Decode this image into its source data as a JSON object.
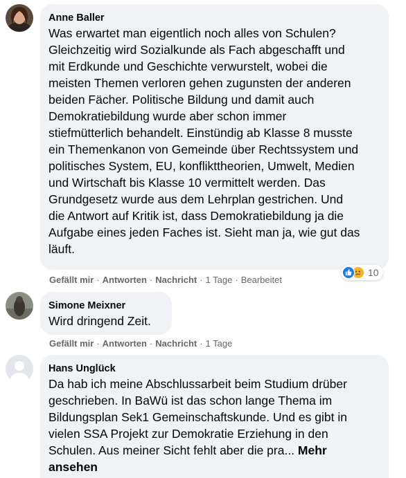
{
  "comments": [
    {
      "author": "Anne Baller",
      "lines": [
        "Was erwartet man eigentlich noch alles von Schulen?",
        "Gleichzeitig wird Sozialkunde als Fach abgeschafft und",
        "mit Erdkunde und Geschichte verwurstelt, wobei die",
        "meisten Themen verloren gehen zugunsten der anderen",
        "beiden Fächer. Politische Bildung und damit auch",
        "Demokratiebildung wurde aber schon immer",
        "stiefmütterlich behandelt. Einstündig ab Klasse 8 musste",
        "ein Themenkanon von Gemeinde über Rechtssystem und",
        "politisches System, EU, konflikttheorien, Umwelt, Medien",
        "und Wirtschaft bis Klasse 10 vermittelt werden. Das",
        "Grundgesetz wurde aus dem Lehrplan gestrichen. Und",
        "die Antwort auf Kritik ist, dass Demokratiebildung ja die",
        "Aufgabe eines jeden Faches ist. Sieht man ja, wie gut das",
        "läuft."
      ],
      "like_label": "Gefällt mir",
      "reply_label": "Antworten",
      "message_label": "Nachricht",
      "time": "1 Tage",
      "edited": "Bearbeitet",
      "reaction_count": "10",
      "reaction_icons": [
        "like-icon",
        "sad-icon"
      ]
    },
    {
      "author": "Simone Meixner",
      "lines": [
        "Wird dringend Zeit."
      ],
      "like_label": "Gefällt mir",
      "reply_label": "Antworten",
      "message_label": "Nachricht",
      "time": "1 Tage"
    },
    {
      "author": "Hans Unglück",
      "lines": [
        "Da hab ich meine Abschlussarbeit beim Studium drüber",
        "geschrieben. In BaWü ist das schon lange Thema im",
        "Bildungsplan Sek1 Gemeinschaftskunde. Und es gibt in",
        "vielen SSA Projekt zur Demokratie Erziehung in den",
        "Schulen. Aus meiner Sicht fehlt aber die pra... "
      ],
      "more_label_1": "Mehr",
      "more_label_2": "ansehen"
    }
  ],
  "colors": {
    "bubble": "#f0f2f5",
    "meta_text": "#65676b",
    "like_blue": "#1877f2",
    "sad_yellow": "#f7b125"
  }
}
